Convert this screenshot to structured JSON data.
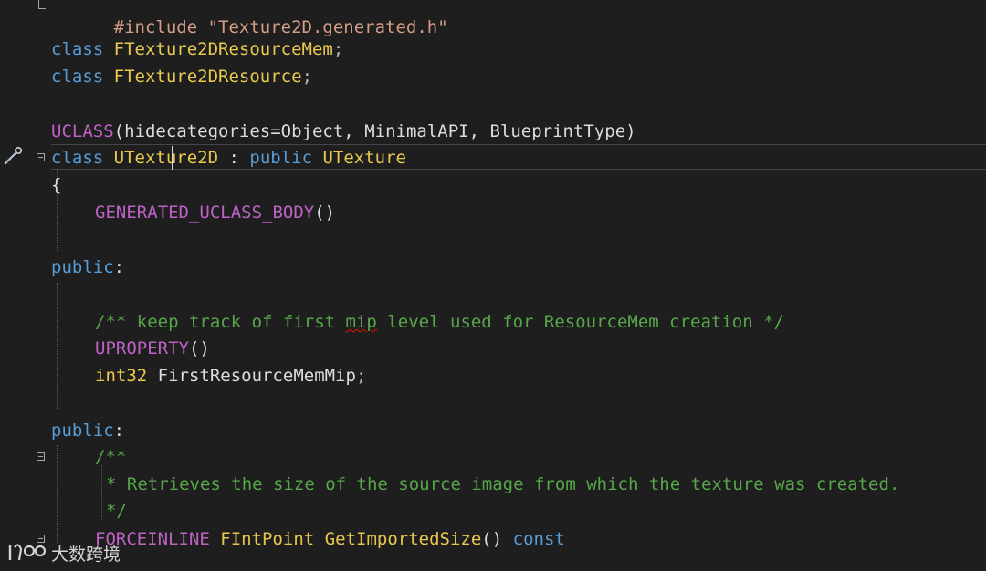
{
  "editor": {
    "lines": {
      "l0": {
        "text": "#include \"Texture2D.generated.h\""
      },
      "l1": {
        "kw": "class",
        "name": "FTexture2DResourceMem",
        "end": ";"
      },
      "l2": {
        "kw": "class",
        "name": "FTexture2DResource",
        "end": ";"
      },
      "l3": {
        "macro": "UCLASS",
        "open": "(",
        "args": "hidecategories=Object, MinimalAPI, BlueprintType",
        "close": ")"
      },
      "l4": {
        "kw": "class",
        "name": "UTexture2D",
        "sep": " : ",
        "kw2": "public",
        "base": "UTexture"
      },
      "l5": {
        "text": "{"
      },
      "l6": {
        "macro": "GENERATED_UCLASS_BODY",
        "parens": "()"
      },
      "l7": {
        "kw": "public",
        "colon": ":"
      },
      "l8": {
        "comment_a": "/** keep track of first ",
        "comment_b": "mip",
        "comment_c": " level used for ResourceMem creation */"
      },
      "l9": {
        "macro": "UPROPERTY",
        "parens": "()"
      },
      "l10": {
        "type": "int32",
        "name": " FirstResourceMemMip",
        "end": ";"
      },
      "l11": {
        "kw": "public",
        "colon": ":"
      },
      "l12": {
        "comment": "/**"
      },
      "l13": {
        "comment": "* Retrieves the size of the source image from which the texture was created."
      },
      "l14": {
        "comment": "*/"
      },
      "l15": {
        "macro": "FORCEINLINE",
        "type": "FIntPoint",
        "fn": "GetImportedSize",
        "parens": "()",
        "kw": "const"
      }
    }
  },
  "watermark": {
    "text": "大数跨境"
  },
  "icons": {
    "gutter": "paintbrush-icon",
    "watermark": "logo-icon"
  },
  "colors": {
    "background": "#1e1e1e",
    "keyword": "#569cd6",
    "class_name": "#e8c84d",
    "macro": "#bd63c5",
    "comment": "#57a64a"
  }
}
